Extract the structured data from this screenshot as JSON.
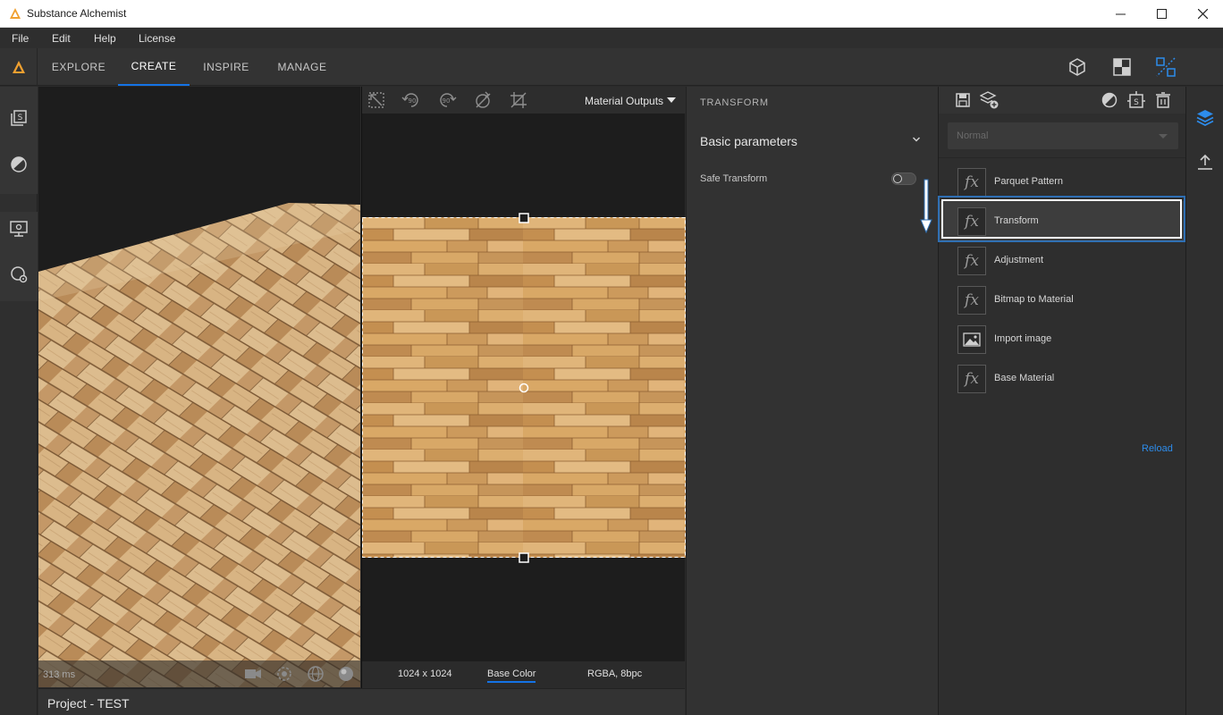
{
  "window": {
    "title": "Substance Alchemist"
  },
  "menu": [
    "File",
    "Edit",
    "Help",
    "License"
  ],
  "nav": {
    "tabs": [
      "EXPLORE",
      "CREATE",
      "INSPIRE",
      "MANAGE"
    ],
    "active_tab": "CREATE"
  },
  "viewport3d": {
    "render_time": "313 ms"
  },
  "project": {
    "name": "Project - TEST"
  },
  "view2d": {
    "output_select": "Material Outputs",
    "resolution": "1024 x 1024",
    "channel": "Base Color",
    "format": "RGBA, 8bpc"
  },
  "properties": {
    "header": "TRANSFORM",
    "section": "Basic parameters",
    "params": [
      {
        "label": "Safe Transform",
        "value": false
      }
    ]
  },
  "layers": {
    "blend_mode": "Normal",
    "items": [
      {
        "name": "Parquet Pattern",
        "icon": "fx-icon",
        "selected": false
      },
      {
        "name": "Transform",
        "icon": "fx-icon",
        "selected": true
      },
      {
        "name": "Adjustment",
        "icon": "fx-icon",
        "selected": false
      },
      {
        "name": "Bitmap to Material",
        "icon": "fx-icon",
        "selected": false
      },
      {
        "name": "Import image",
        "icon": "image-icon",
        "selected": false
      },
      {
        "name": "Base Material",
        "icon": "fx-icon",
        "selected": false
      }
    ],
    "reload_label": "Reload"
  },
  "colors": {
    "accent": "#1473e6",
    "link": "#2d8ceb",
    "wood_light": "#d9b27e",
    "wood_dark": "#b07a45"
  }
}
